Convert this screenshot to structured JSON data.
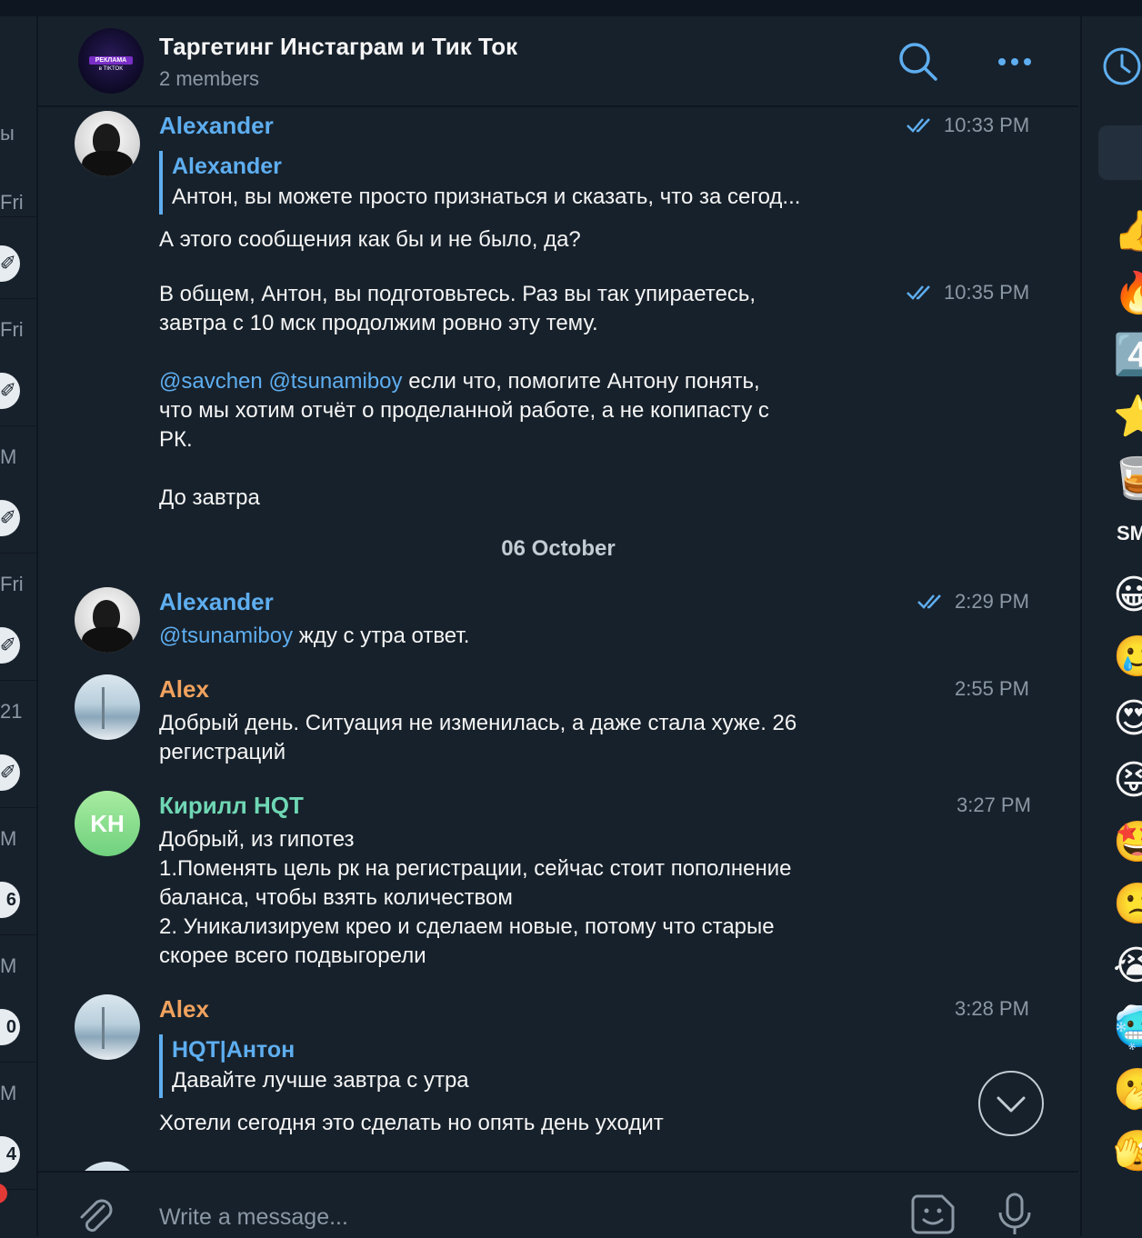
{
  "left_sidebar": {
    "rows": [
      {
        "time": "ы",
        "badge": ""
      },
      {
        "time": "Fri",
        "badge": "pin"
      },
      {
        "time": "Fri",
        "badge": "pin"
      },
      {
        "time": "M",
        "badge": "pin"
      },
      {
        "time": "Fri",
        "badge": "pin"
      },
      {
        "time": "21",
        "badge": "pin"
      },
      {
        "time": "M",
        "badge": "6"
      },
      {
        "time": "M",
        "badge": "0"
      },
      {
        "time": "M",
        "badge": "4"
      }
    ]
  },
  "header": {
    "title": "Таргетинг Инстаграм и Тик Ток",
    "subtitle": "2 members",
    "avatar_text_1": "РЕКЛАМА",
    "avatar_text_2": "в TIKTOK",
    "icons": [
      "search-icon",
      "more-icon",
      "clock-icon"
    ]
  },
  "messages": [
    {
      "sender": "Alexander",
      "time": "10:33 PM",
      "read": true,
      "reply_to": {
        "name": "Alexander",
        "text": "Антон, вы можете просто признаться и сказать, что за сегод..."
      },
      "text": "А этого сообщения как бы и не было, да?"
    },
    {
      "sender": "Alexander",
      "time": "10:35 PM",
      "read": true,
      "text_line1": "В общем, Антон, вы подготовьтесь. Раз вы так упираетесь,",
      "text_line2": "завтра с 10 мск продолжим ровно эту тему.",
      "mention1": "@savchen",
      "mention2": "@tsunamiboy",
      "text_line3": " если что, помогите Антону понять,",
      "text_line4": "что мы хотим отчёт о проделанной работе, а не копипасту с",
      "text_line5": "РК.",
      "text_line6": "До завтра"
    },
    {
      "date_separator": "06 October"
    },
    {
      "sender": "Alexander",
      "time": "2:29 PM",
      "read": true,
      "mention": "@tsunamiboy",
      "text": " жду с утра ответ."
    },
    {
      "sender": "Alex",
      "time": "2:55 PM",
      "text_line1": "Добрый день. Ситуация не изменилась, а даже стала хуже. 26",
      "text_line2": "регистраций"
    },
    {
      "sender": "Кирилл HQT",
      "avatar_initials": "KH",
      "time": "3:27 PM",
      "text_line1": "Добрый, из гипотез",
      "text_line2": "1.Поменять цель рк на регистрации, сейчас стоит пополнение",
      "text_line3": "баланса, чтобы взять количеством",
      "text_line4": "2. Уникализируем крео и сделаем новые, потому что старые",
      "text_line5": "скорее всего подвыгорели"
    },
    {
      "sender": "Alex",
      "time": "3:28 PM",
      "reply_to": {
        "name": "HQT|Антон",
        "text": "Давайте лучше завтра с утра"
      },
      "text": "Хотели сегодня это сделать но опять день уходит"
    }
  ],
  "right_panel": {
    "emojis_top": [
      "👍",
      "🔥",
      "4️⃣",
      "⭐",
      "🥃"
    ],
    "section_label": "SM",
    "emojis_smileys": [
      "😀",
      "🥲",
      "😍",
      "😝",
      "🤩",
      "🙁",
      "😭",
      "🥶",
      "🫢",
      "🫣"
    ]
  },
  "input": {
    "placeholder": "Write a message..."
  }
}
